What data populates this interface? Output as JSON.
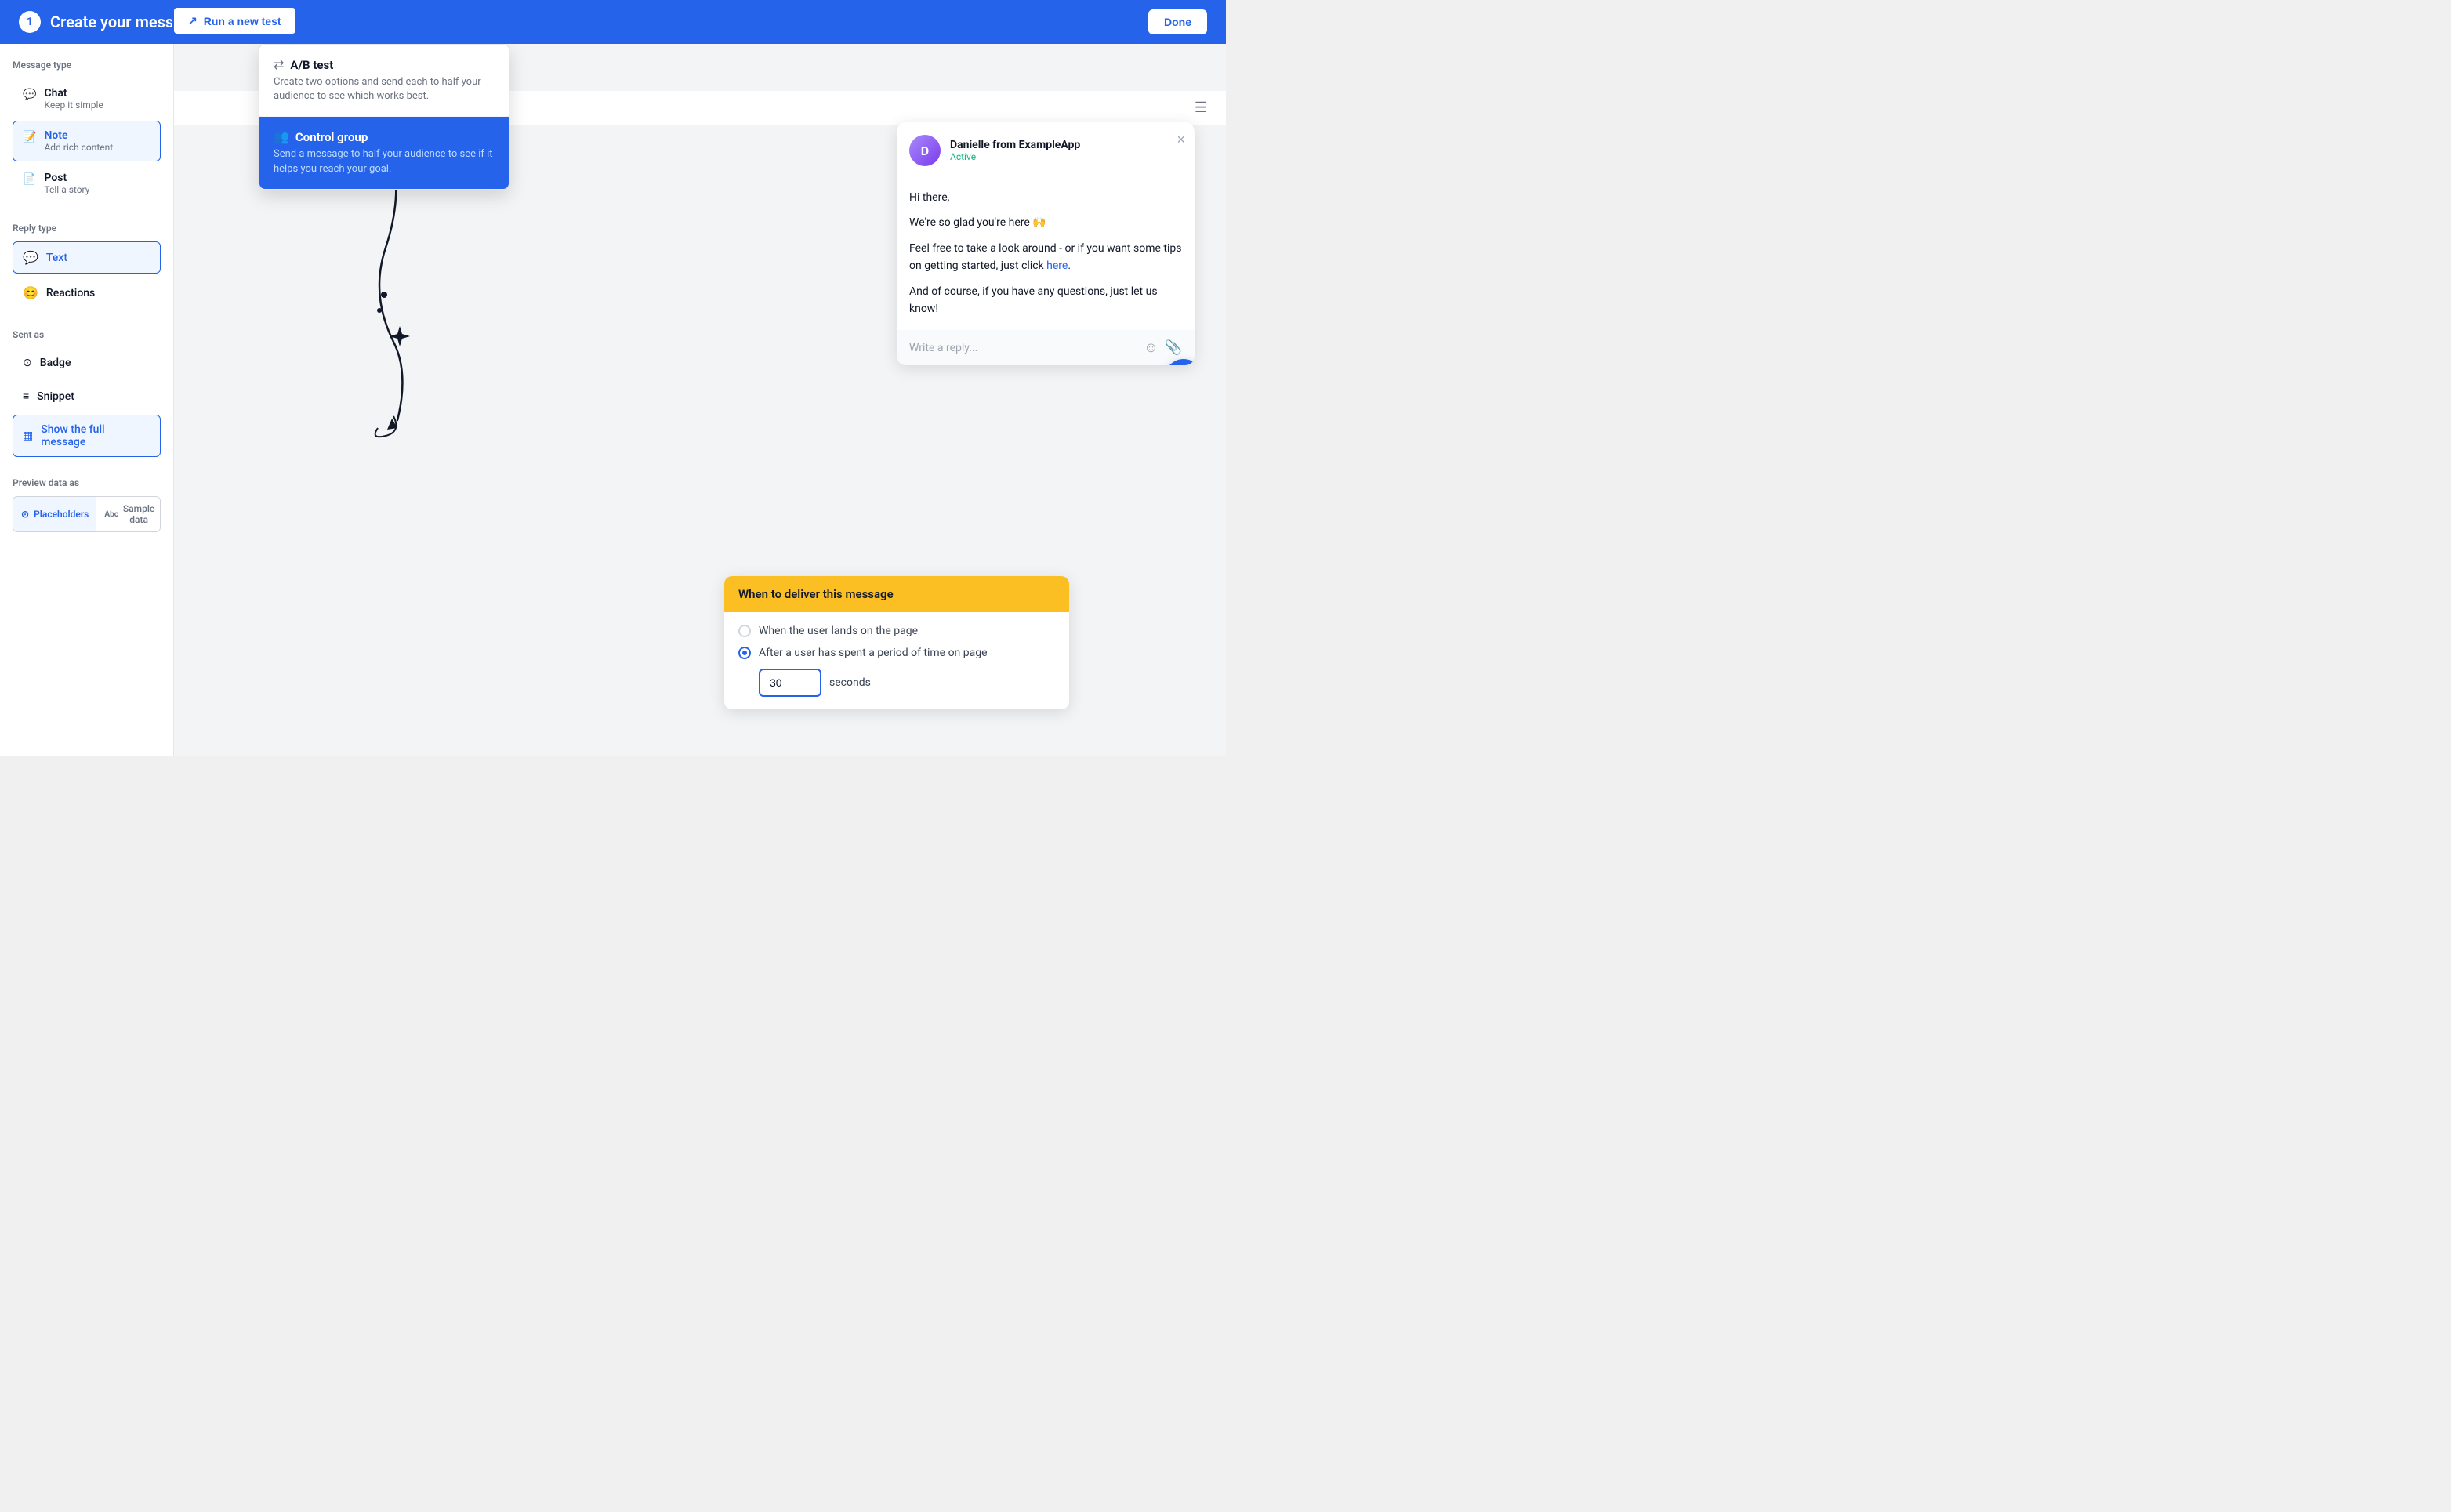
{
  "header": {
    "step_number": "1",
    "title": "Create your message",
    "run_test_label": "Run a new test",
    "done_label": "Done"
  },
  "left_panel": {
    "message_type_label": "Message type",
    "message_types": [
      {
        "id": "chat",
        "icon": "💬",
        "title": "Chat",
        "subtitle": "Keep it simple",
        "selected": false
      },
      {
        "id": "note",
        "icon": "📝",
        "title": "Note",
        "subtitle": "Add rich content",
        "selected": true
      },
      {
        "id": "post",
        "icon": "📄",
        "title": "Post",
        "subtitle": "Tell a story",
        "selected": false
      }
    ],
    "reply_type_label": "Reply type",
    "reply_types": [
      {
        "id": "text",
        "icon": "💬",
        "title": "Text",
        "selected": true
      },
      {
        "id": "reactions",
        "icon": "😊",
        "title": "Reactions",
        "selected": false
      }
    ],
    "sent_as_label": "Sent as",
    "sent_as_options": [
      {
        "id": "badge",
        "icon": "⊙",
        "title": "Badge",
        "selected": false
      },
      {
        "id": "snippet",
        "icon": "≡",
        "title": "Snippet",
        "selected": false
      },
      {
        "id": "full",
        "icon": "▦",
        "title": "Show the full message",
        "selected": true
      }
    ],
    "preview_label": "Preview data as",
    "preview_options": [
      {
        "id": "placeholders",
        "icon": "⊙",
        "title": "Placeholders",
        "selected": true
      },
      {
        "id": "sample",
        "icon": "Abc",
        "title": "Sample data",
        "selected": false
      }
    ]
  },
  "dropdown": {
    "items": [
      {
        "id": "ab_test",
        "icon": "⇄",
        "title": "A/B test",
        "description": "Create two options and send each to half your audience to see which works best.",
        "highlighted": false
      },
      {
        "id": "control_group",
        "icon": "👥",
        "title": "Control group",
        "description": "Send a message to half your audience to see if it helps you reach your goal.",
        "highlighted": true
      }
    ]
  },
  "message_card": {
    "sender_name": "Danielle from ExampleApp",
    "sender_status": "Active",
    "body_lines": [
      "Hi there,",
      "We're so glad you're here 🙌",
      "Feel free to take a look around - or if you want some tips on getting started, just click here.",
      "And of course, if you have any questions, just let us know!"
    ],
    "link_text": "here",
    "reply_placeholder": "Write a reply..."
  },
  "delivery_card": {
    "header": "When to deliver this message",
    "option1": "When the user lands on the page",
    "option2": "After a user has spent a period of time on page",
    "seconds_value": "30",
    "seconds_label": "seconds"
  }
}
